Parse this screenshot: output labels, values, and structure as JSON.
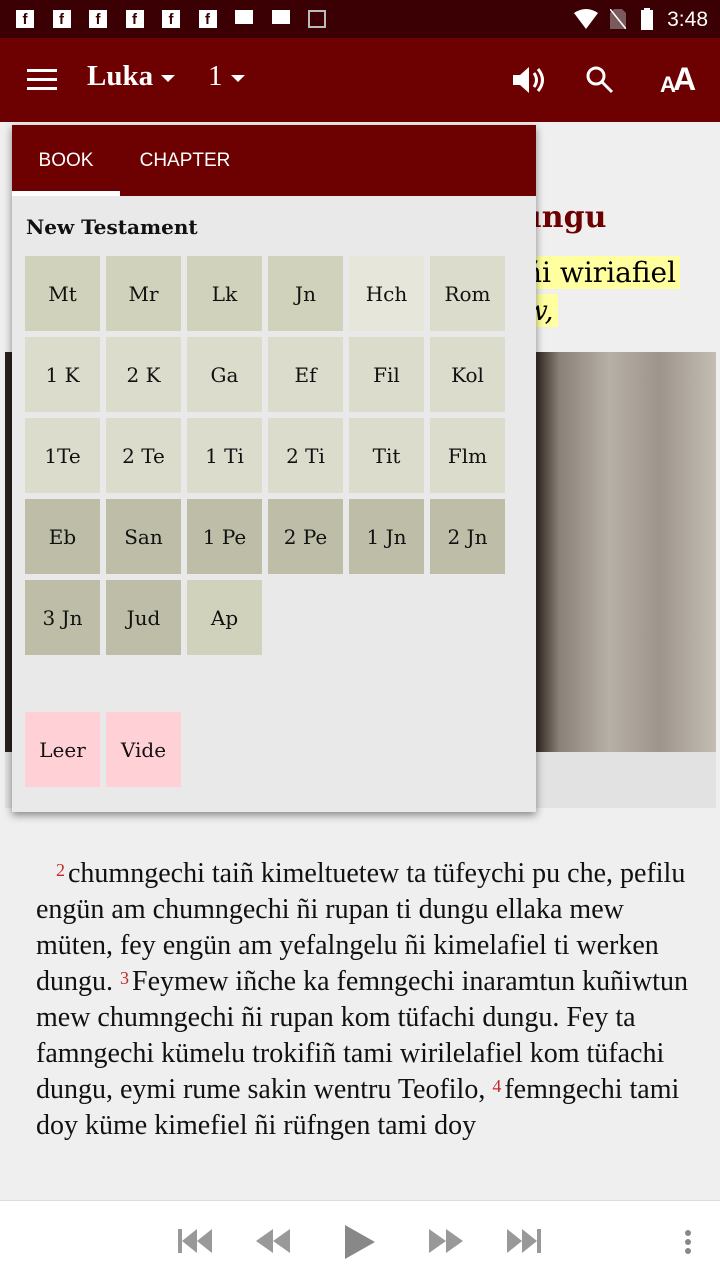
{
  "status": {
    "time": "3:48",
    "notifications": [
      "facebook-icon",
      "facebook-icon",
      "facebook-icon",
      "facebook-icon",
      "facebook-icon",
      "facebook-icon",
      "message-icon",
      "message-icon",
      "image-icon"
    ]
  },
  "appbar": {
    "book": "Luka",
    "chapter": "1",
    "icons": [
      "menu-icon",
      "volume-icon",
      "search-icon",
      "text-size-icon"
    ]
  },
  "content": {
    "title_fragment": "ungu",
    "highlight_line1": "ñi wiriafiel",
    "highlight_line2": "w,"
  },
  "popup": {
    "tabs": [
      {
        "label": "BOOK",
        "active": true
      },
      {
        "label": "CHAPTER",
        "active": false
      }
    ],
    "section": "New Testament",
    "books": [
      {
        "label": "Mt",
        "color": "#d0d2bc"
      },
      {
        "label": "Mr",
        "color": "#d0d2bc"
      },
      {
        "label": "Lk",
        "color": "#d0d2bc"
      },
      {
        "label": "Jn",
        "color": "#d0d2bc"
      },
      {
        "label": "Hch",
        "color": "#e6e7da"
      },
      {
        "label": "Rom",
        "color": "#dbdccb"
      },
      {
        "label": "1 K",
        "color": "#dbdccb"
      },
      {
        "label": "2 K",
        "color": "#dbdccb"
      },
      {
        "label": "Ga",
        "color": "#dbdccb"
      },
      {
        "label": "Ef",
        "color": "#dbdccb"
      },
      {
        "label": "Fil",
        "color": "#dbdccb"
      },
      {
        "label": "Kol",
        "color": "#dbdccb"
      },
      {
        "label": "1Te",
        "color": "#dbdccb"
      },
      {
        "label": "2 Te",
        "color": "#dbdccb"
      },
      {
        "label": "1 Ti",
        "color": "#dbdccb"
      },
      {
        "label": "2 Ti",
        "color": "#dbdccb"
      },
      {
        "label": "Tit",
        "color": "#dbdccb"
      },
      {
        "label": "Flm",
        "color": "#dbdccb"
      },
      {
        "label": "Eb",
        "color": "#bdbda8"
      },
      {
        "label": "San",
        "color": "#bdbda8"
      },
      {
        "label": "1 Pe",
        "color": "#bdbda8"
      },
      {
        "label": "2 Pe",
        "color": "#bdbda8"
      },
      {
        "label": "1 Jn",
        "color": "#bdbda8"
      },
      {
        "label": "2 Jn",
        "color": "#bdbda8"
      },
      {
        "label": "3 Jn",
        "color": "#bdbda8"
      },
      {
        "label": "Jud",
        "color": "#bdbda8"
      },
      {
        "label": "Ap",
        "color": "#d0d2bc"
      }
    ],
    "extras": [
      {
        "label": "Leer",
        "color": "#ffd0d6"
      },
      {
        "label": "Vide",
        "color": "#ffd0d6"
      }
    ]
  },
  "verses": [
    {
      "num": "2",
      "text": "chumngechi taiñ kimeltuetew ta tüfeychi pu che, pefilu engün am chumngechi ñi rupan ti dungu ellaka mew müten, fey engün am yefalngelu ñi kimelafiel ti werken dungu."
    },
    {
      "num": "3",
      "text": "Feymew iñche ka femngechi inaramtun kuñiwtun mew chumngechi ñi rupan kom tüfachi dungu. Fey ta famngechi kümelu trokifiñ tami wirilelafiel kom tüfachi dungu, eymi rume sakin wentru Teofilo,"
    },
    {
      "num": "4",
      "text": "femngechi tami doy küme kimefiel ñi rüfngen tami doy"
    }
  ],
  "player": {
    "controls": [
      "skip-first-icon",
      "rewind-icon",
      "play-icon",
      "fast-forward-icon",
      "skip-last-icon",
      "more-vert-icon"
    ]
  },
  "colors": {
    "primary": "#6d0000",
    "statusbar": "#3a0004",
    "verse_number": "#c62828",
    "highlight": "#ffff9f"
  }
}
